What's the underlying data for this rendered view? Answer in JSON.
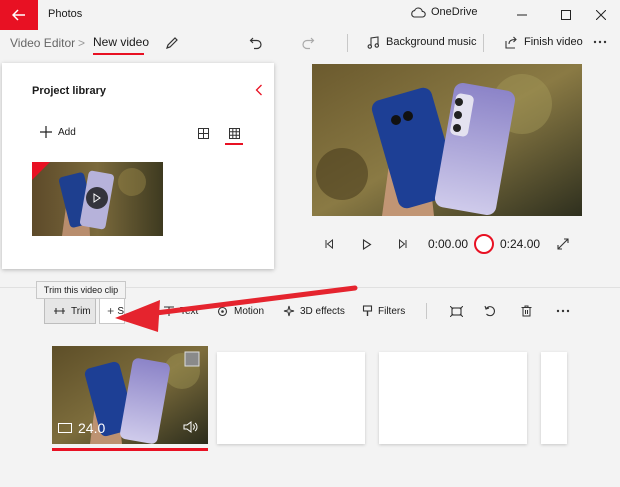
{
  "app": {
    "title": "Photos",
    "cloud_label": "OneDrive"
  },
  "breadcrumb": {
    "root": "Video Editor",
    "separator": ">",
    "current": "New video"
  },
  "commands": {
    "background_music": "Background music",
    "finish_video": "Finish video"
  },
  "library": {
    "title": "Project library",
    "add_label": "Add"
  },
  "player": {
    "current_time": "0:00.00",
    "total_time": "0:24.00"
  },
  "tooltip": {
    "text": "Trim this video clip"
  },
  "storyboard_tools": {
    "trim": "Trim",
    "split_partial": "S",
    "text": "Text",
    "motion": "Motion",
    "effects_3d": "3D effects",
    "filters": "Filters"
  },
  "clip": {
    "duration": "24.0"
  },
  "colors": {
    "accent": "#e81123",
    "arrow": "#e5242e"
  }
}
